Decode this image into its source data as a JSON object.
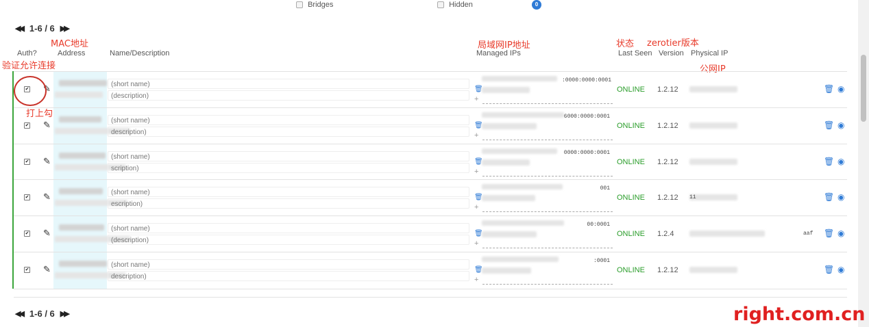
{
  "filters": {
    "bridges_label": "Bridges",
    "hidden_label": "Hidden",
    "hidden_count": "0"
  },
  "pager": {
    "range": "1-6 / 6"
  },
  "headers": {
    "auth": "Auth?",
    "address": "Address",
    "name": "Name/Description",
    "managed_ips": "Managed IPs",
    "last_seen": "Last Seen",
    "version": "Version",
    "physical_ip": "Physical IP"
  },
  "annotations": {
    "mac": "MAC地址",
    "auth": "验证允许连接",
    "check": "打上勾",
    "lan_ip": "局域网IP地址",
    "status": "状态",
    "zt_version": "zerotier版本",
    "public_ip": "公网IP"
  },
  "rows": [
    {
      "name_placeholder": "(short name)",
      "desc_placeholder": "(description)",
      "ip_tail": ":0000:0000:0001",
      "status": "ONLINE",
      "version": "1.2.12",
      "phys_ip": ""
    },
    {
      "name_placeholder": "(short name)",
      "desc_placeholder": "description)",
      "ip_tail": "6000:0000:0001",
      "status": "ONLINE",
      "version": "1.2.12",
      "phys_ip": ""
    },
    {
      "name_placeholder": "(short name)",
      "desc_placeholder": "scription)",
      "ip_tail": "0000:0000:0001",
      "status": "ONLINE",
      "version": "1.2.12",
      "phys_ip": ""
    },
    {
      "name_placeholder": "(short name)",
      "desc_placeholder": "escription)",
      "ip_tail": "001",
      "status": "ONLINE",
      "version": "1.2.12",
      "phys_ip": "11"
    },
    {
      "name_placeholder": "(short name)",
      "desc_placeholder": "(description)",
      "ip_tail": "00:0001",
      "status": "ONLINE",
      "version": "1.2.4",
      "phys_ip": "aaf"
    },
    {
      "name_placeholder": "(short name)",
      "desc_placeholder": "description)",
      "ip_tail": ":0001",
      "status": "ONLINE",
      "version": "1.2.12",
      "phys_ip": ""
    }
  ],
  "watermark": "right.com.cn"
}
